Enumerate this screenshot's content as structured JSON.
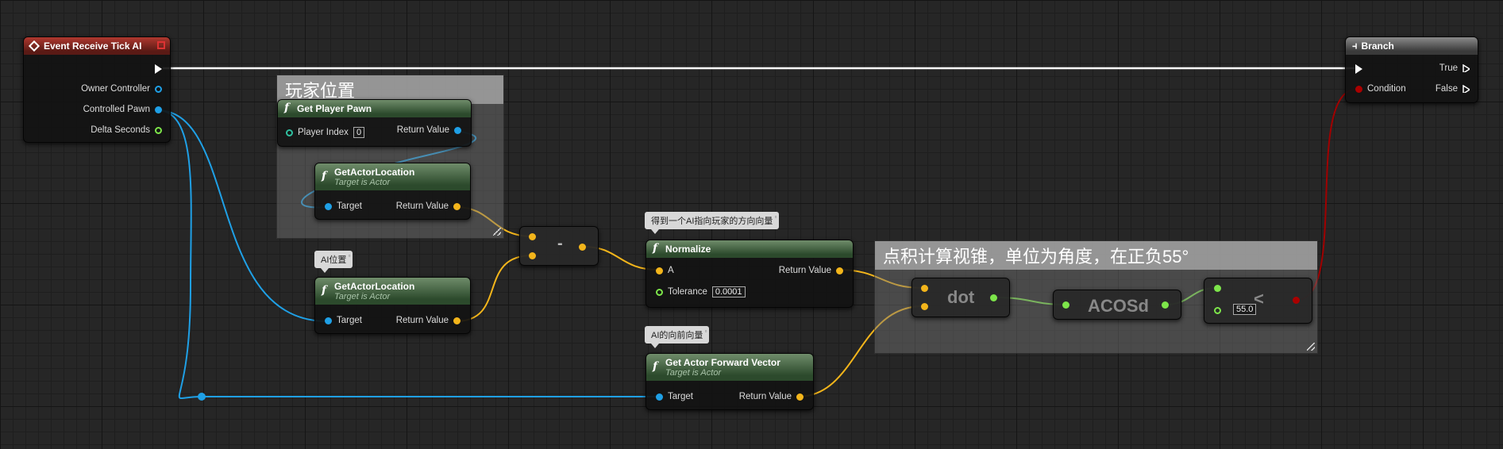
{
  "comments": {
    "player_pos": "玩家位置",
    "dot_cone": "点积计算视锥，单位为角度，在正负55°"
  },
  "notes": {
    "ai_pos": "AI位置",
    "dir_vec": "得到一个AI指向玩家的方向向量",
    "forward_vec": "AI的向前向量"
  },
  "nodes": {
    "event_tick": {
      "title": "Event Receive Tick AI",
      "pins": [
        "Owner Controller",
        "Controlled Pawn",
        "Delta Seconds"
      ]
    },
    "get_player_pawn": {
      "title": "Get Player Pawn",
      "player_index_label": "Player Index",
      "player_index_value": "0",
      "return_label": "Return Value"
    },
    "get_actor_location_1": {
      "title": "GetActorLocation",
      "subtitle": "Target is Actor",
      "target_label": "Target",
      "return_label": "Return Value"
    },
    "get_actor_location_2": {
      "title": "GetActorLocation",
      "subtitle": "Target is Actor",
      "target_label": "Target",
      "return_label": "Return Value"
    },
    "subtract": {
      "label": "-"
    },
    "normalize": {
      "title": "Normalize",
      "a_label": "A",
      "tolerance_label": "Tolerance",
      "tolerance_value": "0.0001",
      "return_label": "Return Value"
    },
    "forward_vector": {
      "title": "Get Actor Forward Vector",
      "subtitle": "Target is Actor",
      "target_label": "Target",
      "return_label": "Return Value"
    },
    "dot": {
      "label": "dot"
    },
    "acosd": {
      "label": "ACOSd"
    },
    "less": {
      "symbol": "<",
      "value": "55.0"
    },
    "branch": {
      "title": "Branch",
      "condition_label": "Condition",
      "true_label": "True",
      "false_label": "False"
    }
  },
  "colors": {
    "exec": "#ffffff",
    "object": "#1fa0e6",
    "vector": "#f3b51b",
    "float": "#7de54a",
    "bool": "#a00000"
  }
}
